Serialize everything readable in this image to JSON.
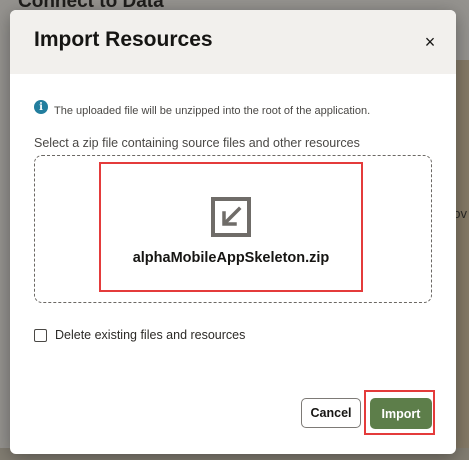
{
  "background": {
    "page_title": "Connect to Data",
    "partial_text": "ov"
  },
  "dialog": {
    "title": "Import Resources",
    "close_label": "×",
    "info_text": "The uploaded file will be unzipped into the root of the application.",
    "select_label": "Select a zip file containing source files and other resources",
    "file_name": "alphaMobileAppSkeleton.zip",
    "delete_checkbox": {
      "label": "Delete existing files and resources",
      "checked": false
    },
    "cancel_label": "Cancel",
    "import_label": "Import"
  },
  "icons": {
    "info": "info-icon",
    "close": "close-icon",
    "file_import": "import-arrow-icon"
  },
  "colors": {
    "primary_button": "#5d7e4a",
    "highlight": "#e43b3b",
    "info": "#227e9e"
  }
}
